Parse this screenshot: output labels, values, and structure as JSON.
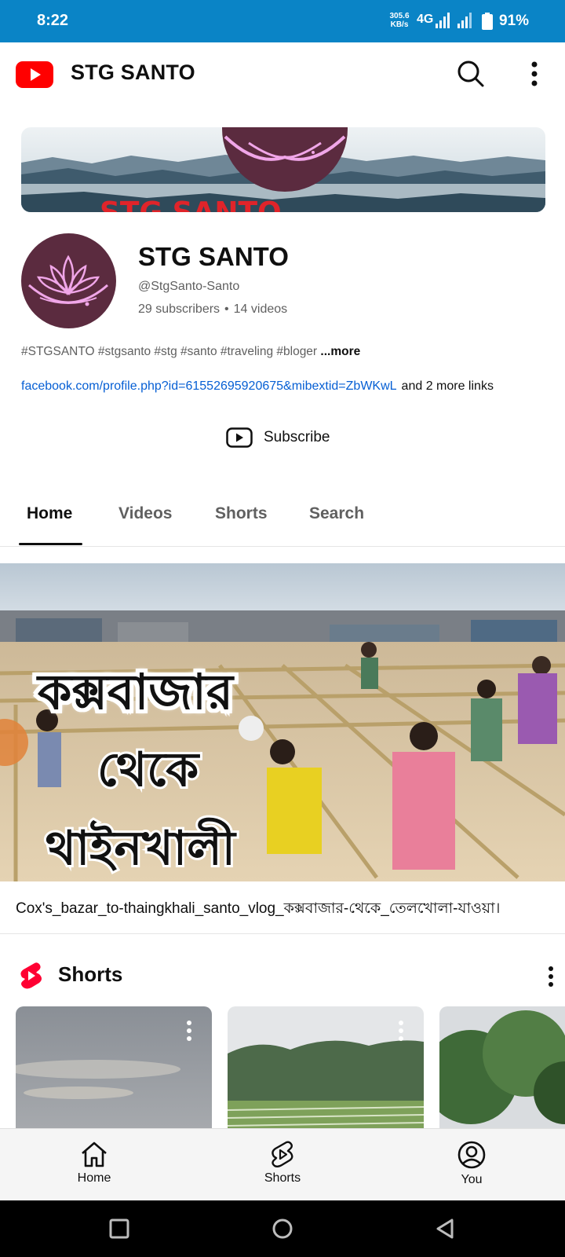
{
  "status_bar": {
    "time": "8:22",
    "net_speed": "305.6",
    "net_speed_unit": "KB/s",
    "net_type": "4G",
    "battery": "91%"
  },
  "app_bar": {
    "title": "STG SANTO",
    "search_icon": "search-icon",
    "more_icon": "more-vert-icon"
  },
  "channel": {
    "name": "STG SANTO",
    "handle": "@StgSanto-Santo",
    "subscribers": "29 subscribers",
    "separator": "•",
    "videos": "14 videos",
    "description": "#STGSANTO #stgsanto #stg #santo #traveling #bloger",
    "description_more": "...more",
    "link_url": "facebook.com/profile.php?id=61552695920675&mibextid=ZbWKwL",
    "link_more": "and 2 more links",
    "subscribe_label": "Subscribe",
    "banner_text": "STG SANTO"
  },
  "tabs": [
    {
      "label": "Home",
      "active": true
    },
    {
      "label": "Videos",
      "active": false
    },
    {
      "label": "Shorts",
      "active": false
    },
    {
      "label": "Search",
      "active": false
    }
  ],
  "featured_video": {
    "thumbnail_lines": [
      "কক্সবাজার",
      "থেকে",
      "থাইনখালী"
    ],
    "title": "Cox's_bazar_to-thaingkhali_santo_vlog_কক্সবাজার-থেকে_তেলখোলা-যাওয়া।"
  },
  "shorts_shelf": {
    "heading": "Shorts",
    "icon": "shorts-icon"
  },
  "bottom_nav": [
    {
      "label": "Home",
      "icon": "home-icon"
    },
    {
      "label": "Shorts",
      "icon": "shorts-icon"
    },
    {
      "label": "You",
      "icon": "account-icon"
    }
  ],
  "colors": {
    "status_bar": "#0a84c6",
    "youtube_red": "#ff0000",
    "link_blue": "#065fd4",
    "avatar_bg": "#5b2b3f",
    "lotus": "#f0a6e8"
  }
}
